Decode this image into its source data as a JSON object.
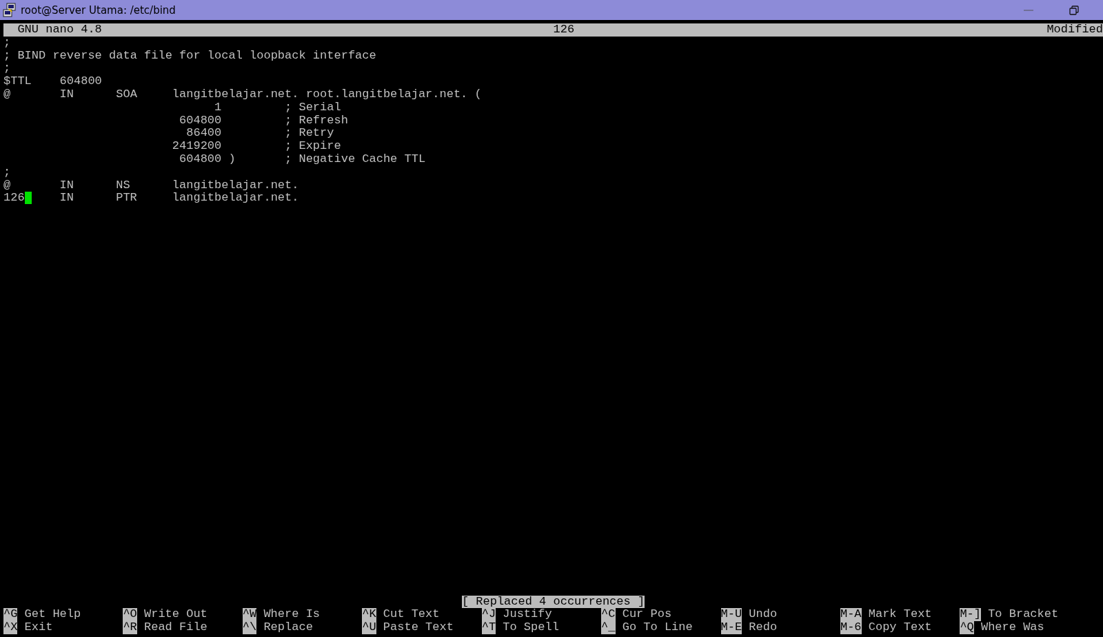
{
  "window": {
    "title": "root@Server Utama: /etc/bind"
  },
  "header": {
    "app": "GNU nano 4.8",
    "file": "126",
    "state": "Modified"
  },
  "lines": [
    {
      "text": ";",
      "cursor": false
    },
    {
      "text": "; BIND reverse data file for local loopback interface",
      "cursor": false
    },
    {
      "text": ";",
      "cursor": false
    },
    {
      "text": "$TTL    604800",
      "cursor": false
    },
    {
      "text": "@       IN      SOA     langitbelajar.net. root.langitbelajar.net. (",
      "cursor": false
    },
    {
      "text": "                              1         ; Serial",
      "cursor": false
    },
    {
      "text": "                         604800         ; Refresh",
      "cursor": false
    },
    {
      "text": "                          86400         ; Retry",
      "cursor": false
    },
    {
      "text": "                        2419200         ; Expire",
      "cursor": false
    },
    {
      "text": "                         604800 )       ; Negative Cache TTL",
      "cursor": false
    },
    {
      "text": ";",
      "cursor": false
    },
    {
      "text": "@       IN      NS      langitbelajar.net.",
      "cursor": false
    },
    {
      "text": "126",
      "cursor": true,
      "rest": "    IN      PTR     langitbelajar.net."
    }
  ],
  "status": "[ Replaced 4 occurrences ]",
  "shortcuts": [
    [
      {
        "key": "^G",
        "label": "Get Help"
      },
      {
        "key": "^O",
        "label": "Write Out"
      },
      {
        "key": "^W",
        "label": "Where Is"
      },
      {
        "key": "^K",
        "label": "Cut Text"
      },
      {
        "key": "^J",
        "label": "Justify"
      },
      {
        "key": "^C",
        "label": "Cur Pos"
      },
      {
        "key": "M-U",
        "label": "Undo"
      },
      {
        "key": "M-A",
        "label": "Mark Text"
      },
      {
        "key": "M-]",
        "label": "To Bracket"
      }
    ],
    [
      {
        "key": "^X",
        "label": "Exit"
      },
      {
        "key": "^R",
        "label": "Read File"
      },
      {
        "key": "^\\",
        "label": "Replace"
      },
      {
        "key": "^U",
        "label": "Paste Text"
      },
      {
        "key": "^T",
        "label": "To Spell"
      },
      {
        "key": "^_",
        "label": "Go To Line"
      },
      {
        "key": "M-E",
        "label": "Redo"
      },
      {
        "key": "M-6",
        "label": "Copy Text"
      },
      {
        "key": "^Q",
        "label": "Where Was"
      }
    ]
  ]
}
